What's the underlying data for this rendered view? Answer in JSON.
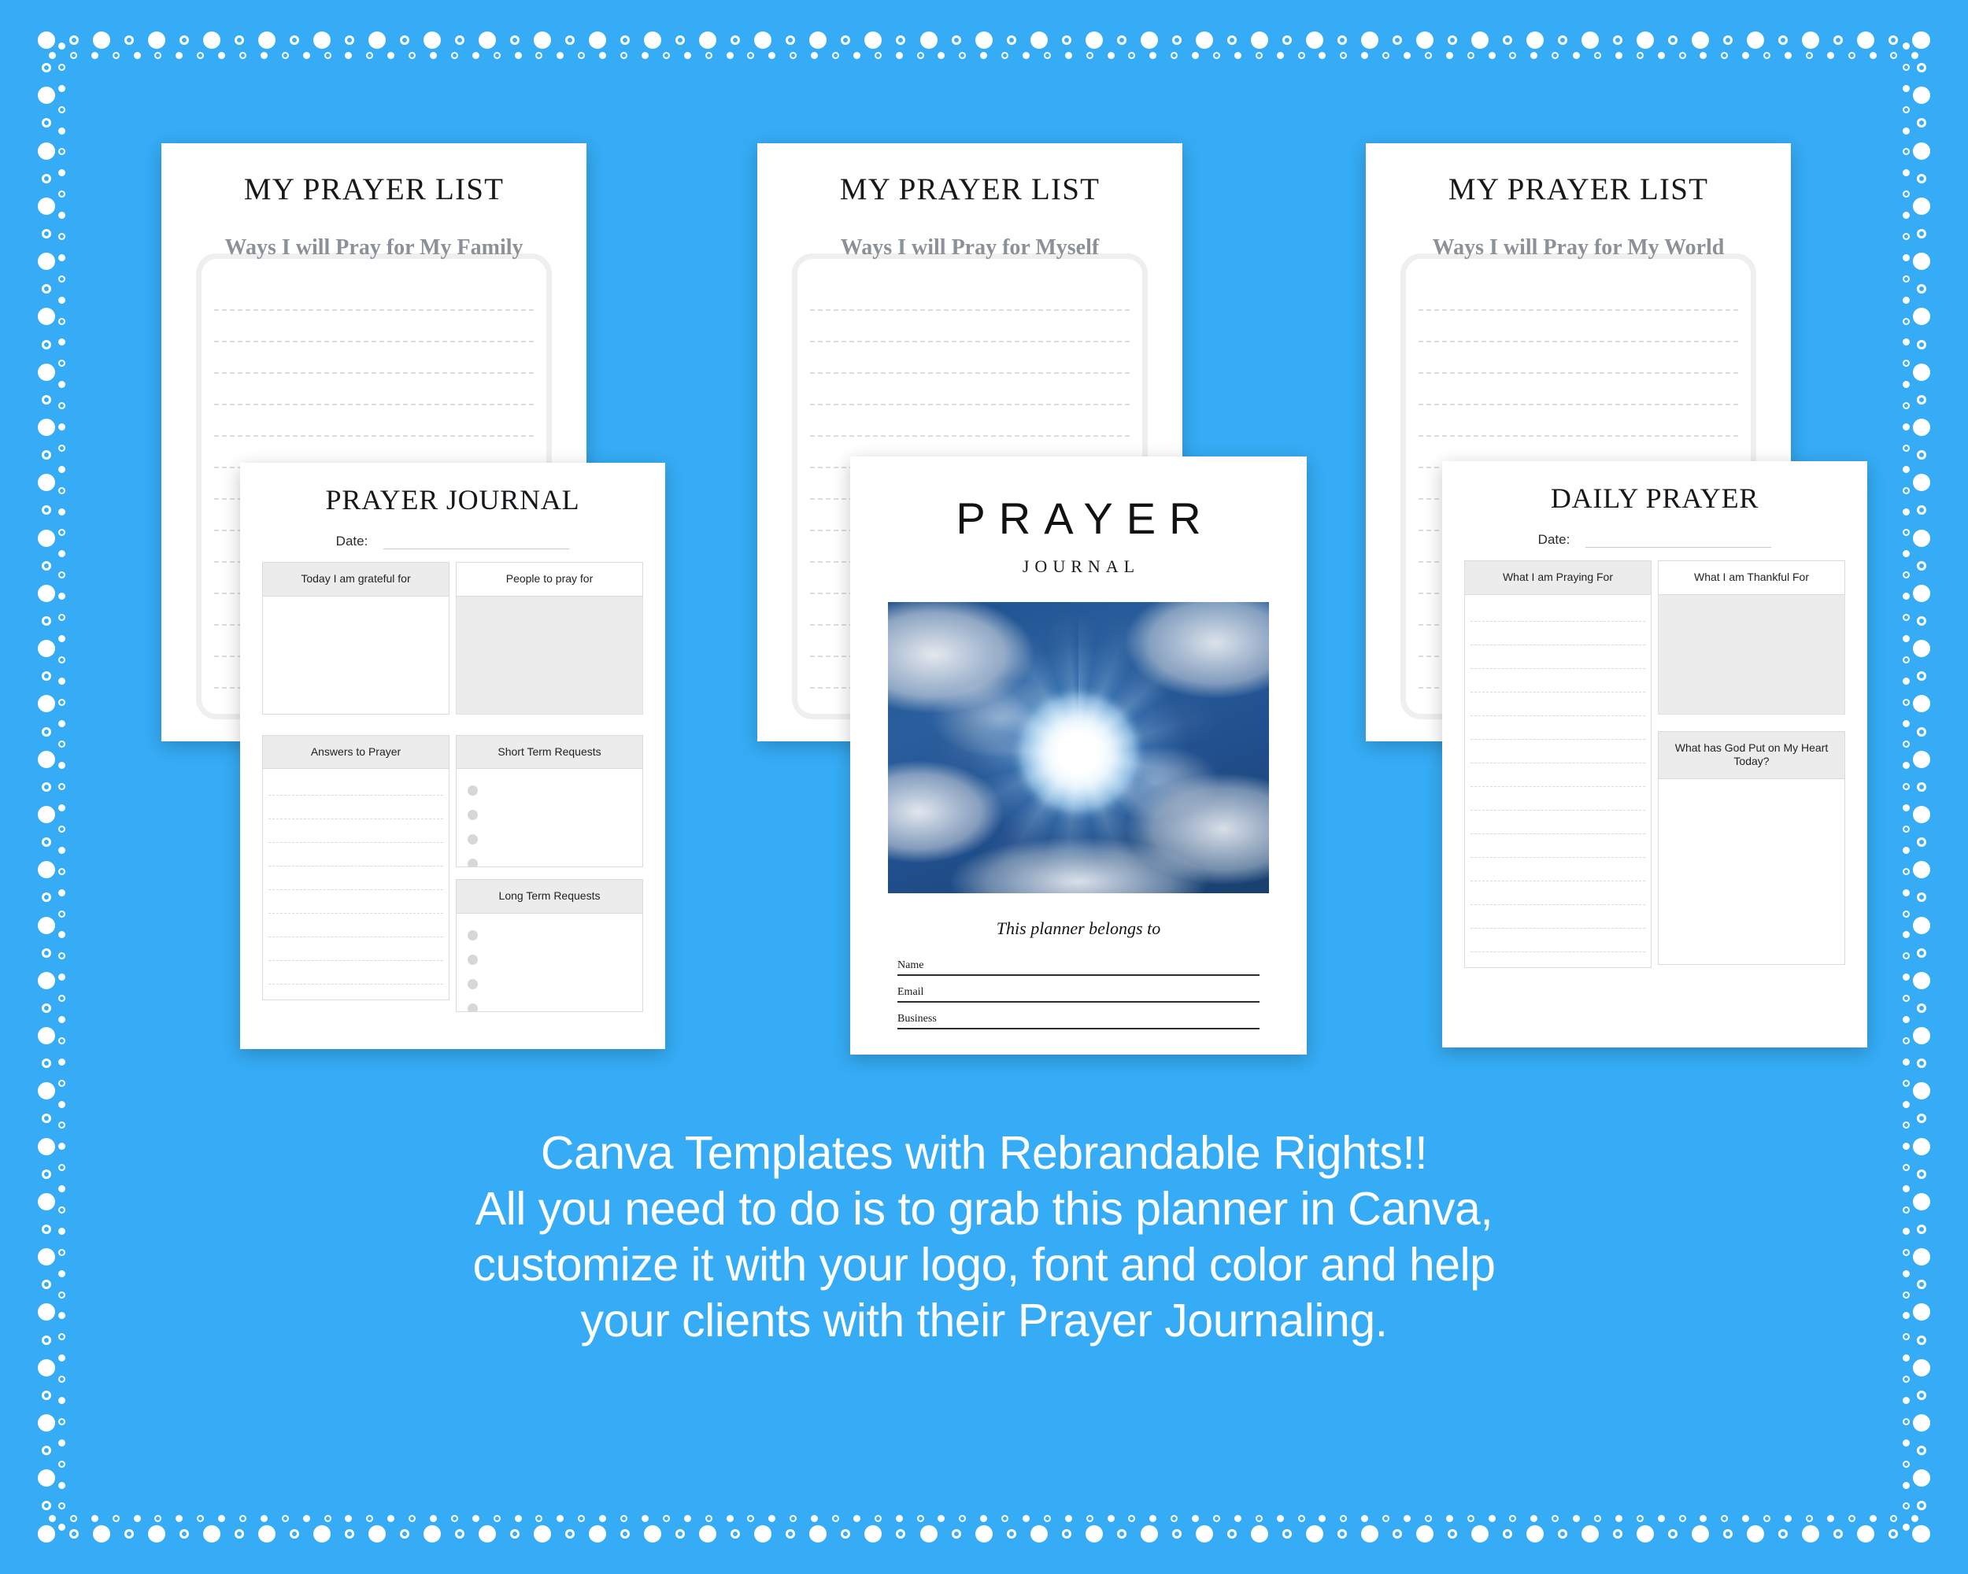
{
  "background_color": "#35ACF5",
  "frame": {
    "style": "dotted-double-border",
    "color": "#FFFFFF"
  },
  "prayer_lists": [
    {
      "title": "MY PRAYER LIST",
      "subtitle": "Ways I will Pray for My Family",
      "line_count": 14
    },
    {
      "title": "MY PRAYER LIST",
      "subtitle": "Ways I will Pray for Myself",
      "line_count": 14
    },
    {
      "title": "MY PRAYER LIST",
      "subtitle": "Ways I will Pray for My World",
      "line_count": 14
    }
  ],
  "prayer_journal": {
    "title": "PRAYER JOURNAL",
    "date_label": "Date:",
    "date_value": "",
    "sections": {
      "grateful": {
        "header": "Today I am grateful for"
      },
      "people": {
        "header": "People to pray for"
      },
      "answers": {
        "header": "Answers to Prayer",
        "line_count": 13
      },
      "short_term": {
        "header": "Short Term Requests",
        "bullet_count": 5
      },
      "long_term": {
        "header": "Long Term Requests",
        "bullet_count": 5
      }
    }
  },
  "cover": {
    "title": "PRAYER",
    "subtitle": "JOURNAL",
    "photo_alt": "sun-through-clouds-photo",
    "belongs_to": "This planner belongs to",
    "fields": [
      {
        "label": "Name",
        "value": ""
      },
      {
        "label": "Email",
        "value": ""
      },
      {
        "label": "Business",
        "value": ""
      }
    ]
  },
  "daily_prayer": {
    "title": "DAILY PRAYER",
    "date_label": "Date:",
    "date_value": "",
    "sections": {
      "praying_for": {
        "header": "What I am Praying For",
        "line_count": 17
      },
      "thankful_for": {
        "header": "What I am Thankful For"
      },
      "on_my_heart": {
        "header": "What has God Put on My Heart Today?"
      }
    }
  },
  "promo": {
    "line1": "Canva Templates with Rebrandable Rights!!",
    "line2": "All you need to do is to grab this planner in Canva,",
    "line3": "customize it with your logo, font and color and help",
    "line4": "your clients with their Prayer Journaling."
  }
}
